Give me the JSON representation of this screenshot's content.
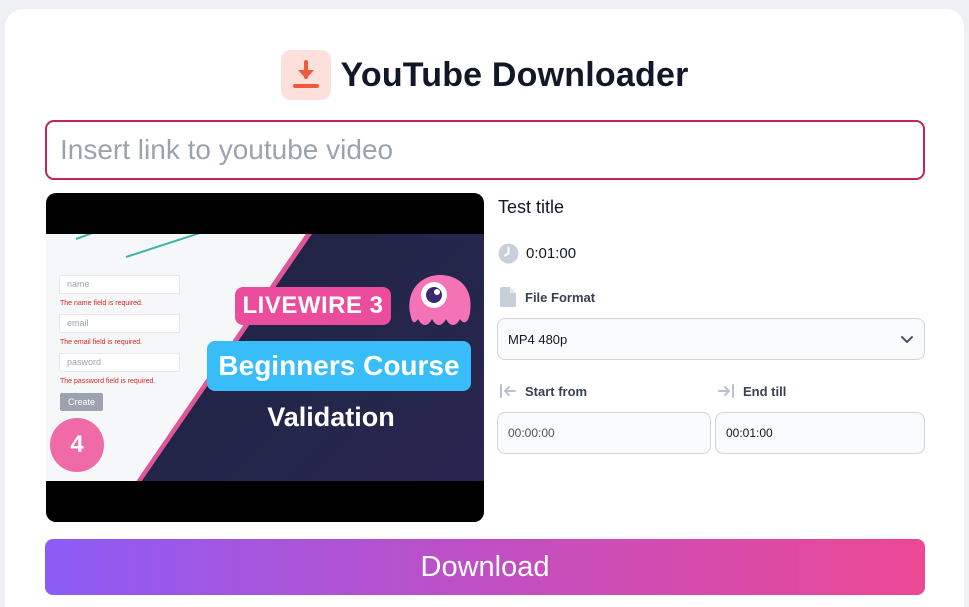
{
  "app": {
    "title": "YouTube Downloader",
    "accent_color": "#ef5a3c",
    "input_border_color": "#c2255c"
  },
  "url_input": {
    "placeholder": "Insert link to youtube video",
    "value": ""
  },
  "thumbnail": {
    "series_badge": "LIVEWIRE 3",
    "course_badge": "Beginners Course",
    "topic": "Validation",
    "episode_number": "4",
    "form_fields": [
      {
        "placeholder": "name",
        "error": "The name field is required."
      },
      {
        "placeholder": "email",
        "error": "The email field is required."
      },
      {
        "placeholder": "pasword",
        "error": "The password field is required."
      }
    ],
    "create_button": "Create"
  },
  "video": {
    "title": "Test title",
    "duration": "0:01:00",
    "duration_icon": "clock-icon"
  },
  "file_format": {
    "label": "File Format",
    "icon": "file-icon",
    "selected": "MP4 480p"
  },
  "trim": {
    "start_label": "Start from",
    "start_icon": "arrow-left-to-line-icon",
    "start_placeholder": "00:00:00",
    "end_label": "End till",
    "end_icon": "arrow-right-to-line-icon",
    "end_value": "00:01:00"
  },
  "download_button": {
    "label": "Download",
    "gradient": [
      "#8b5cf6",
      "#ec4893"
    ]
  }
}
